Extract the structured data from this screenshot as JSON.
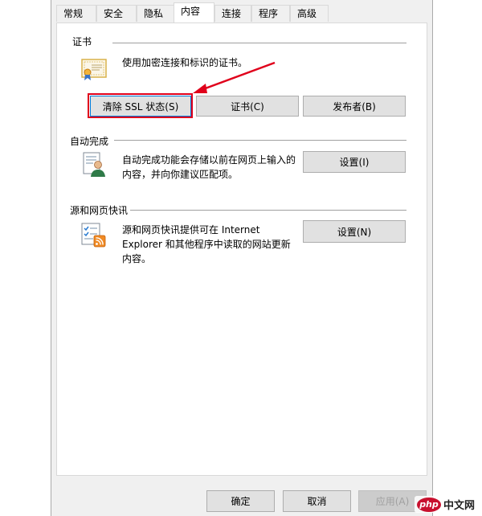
{
  "tabs": [
    "常规",
    "安全",
    "隐私",
    "内容",
    "连接",
    "程序",
    "高级"
  ],
  "active_tab": "内容",
  "certificates": {
    "title": "证书",
    "description": "使用加密连接和标识的证书。",
    "buttons": [
      "清除 SSL 状态(S)",
      "证书(C)",
      "发布者(B)"
    ]
  },
  "autocomplete": {
    "title": "自动完成",
    "description_lines": [
      "自动完成功能会存储以前在网页上输入的",
      "内容，并向你建议匹配项。"
    ],
    "settings_label": "设置(I)"
  },
  "feeds": {
    "title": "源和网页快讯",
    "description_lines": [
      "源和网页快讯提供可在 Internet",
      "Explorer 和其他程序中读取的网站更新",
      "内容。"
    ],
    "settings_label": "设置(N)"
  },
  "footer": {
    "ok_label": "确定",
    "cancel_label": "取消",
    "apply_label": "应用(A)"
  },
  "watermark": {
    "badge": "php",
    "text": "中文网"
  },
  "colors": {
    "annotation_red": "#e0001b",
    "focus_blue": "#0078d7"
  }
}
